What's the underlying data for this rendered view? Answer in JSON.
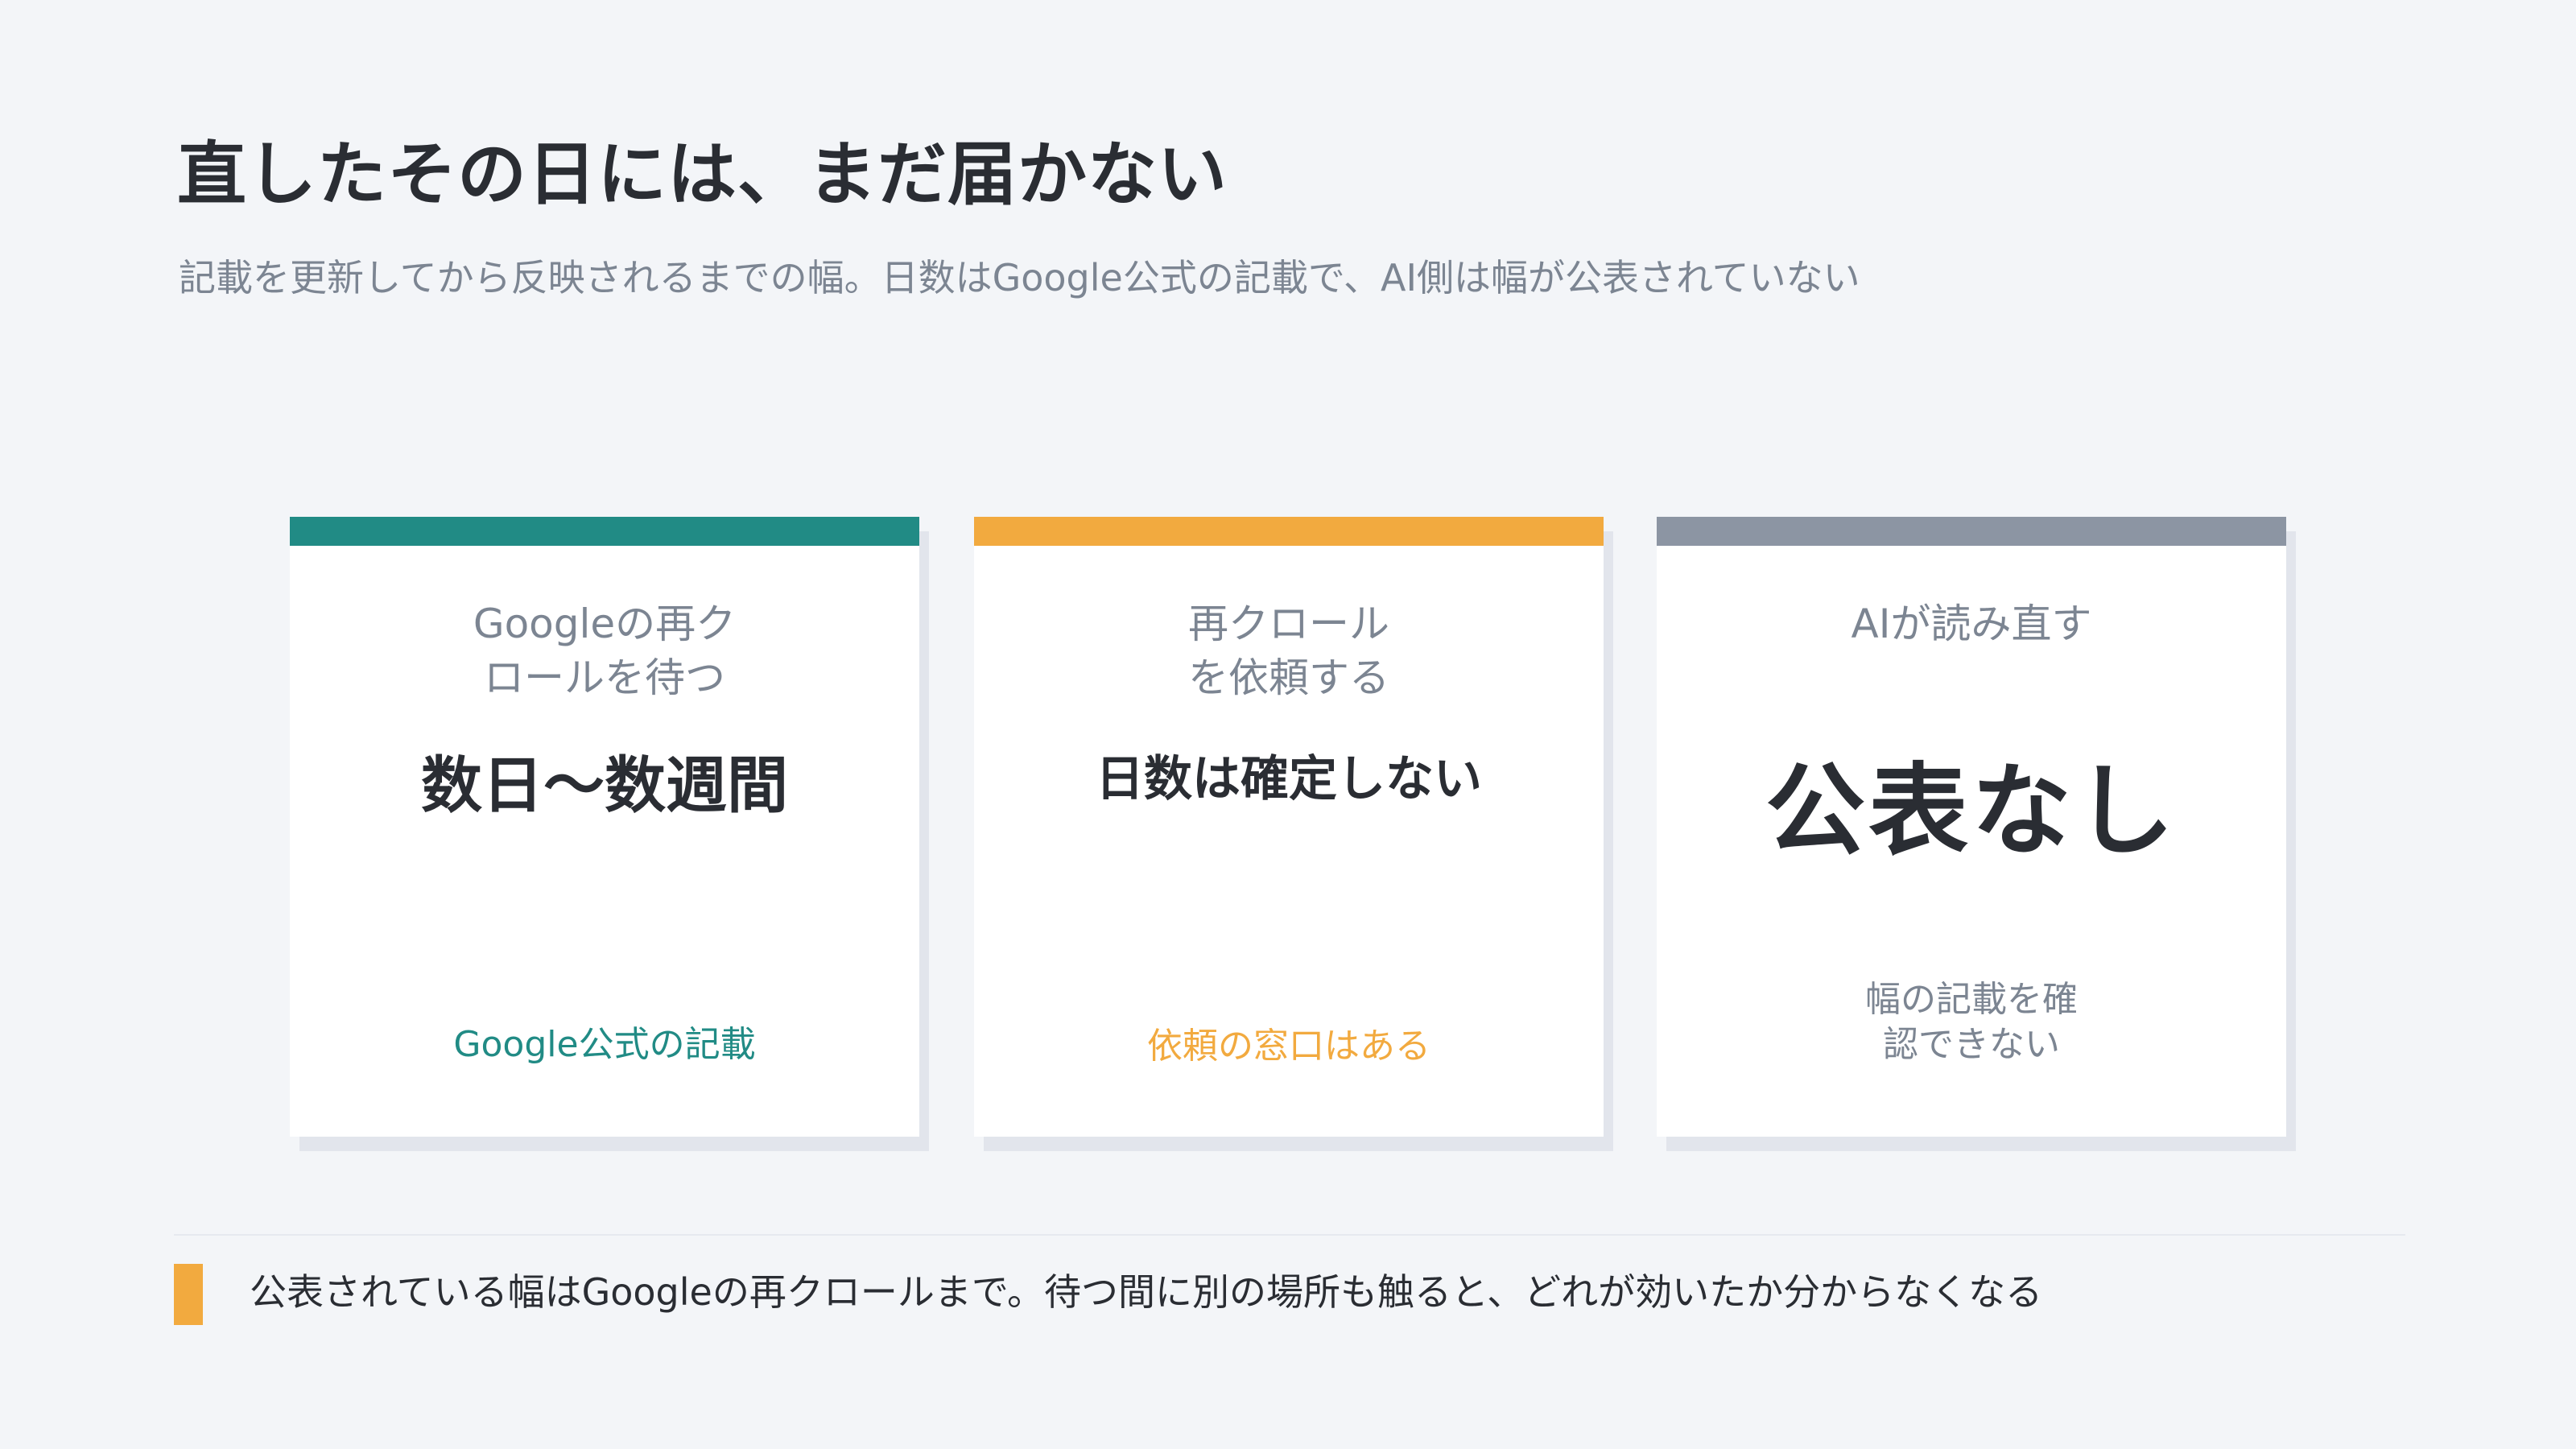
{
  "header": {
    "title": "直したその日には、まだ届かない",
    "subtitle": "記載を更新してから反映されるまでの幅。日数はGoogle公式の記載で、AI側は幅が公表されていない"
  },
  "cards": [
    {
      "label": "Googleの再ク\nロールを待つ",
      "value": "数日〜数週間",
      "note": "Google公式の記載",
      "accent_color": "#218b85",
      "note_color": "#218b85"
    },
    {
      "label": "再クロール\nを依頼する",
      "value": "日数は確定しない",
      "note": "依頼の窓口はある",
      "accent_color": "#f2aa3f",
      "note_color": "#f2aa3f"
    },
    {
      "label": "AIが読み直す",
      "value": "公表なし",
      "note": "幅の記載を確\n認できない",
      "accent_color": "#8c95a3",
      "note_color": "#7c8592"
    }
  ],
  "footer": {
    "text": "公表されている幅はGoogleの再クロールまで。待つ間に別の場所も触ると、どれが効いたか分からなくなる",
    "accent_color": "#f2aa3f"
  },
  "colors": {
    "background": "#f3f5f8",
    "text": "#2a2d33",
    "muted": "#7c8592"
  }
}
